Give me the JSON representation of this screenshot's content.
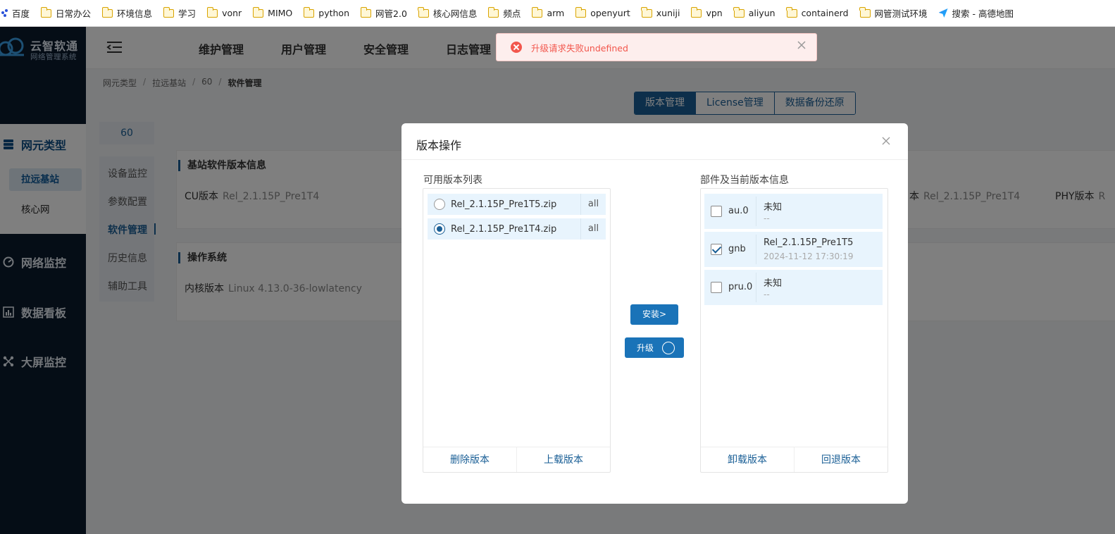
{
  "bookmarks": [
    {
      "label": "百度",
      "icon": "baidu-icon"
    },
    {
      "label": "日常办公",
      "icon": "folder-icon"
    },
    {
      "label": "环境信息",
      "icon": "folder-icon"
    },
    {
      "label": "学习",
      "icon": "folder-icon"
    },
    {
      "label": "vonr",
      "icon": "folder-icon"
    },
    {
      "label": "MIMO",
      "icon": "folder-icon"
    },
    {
      "label": "python",
      "icon": "folder-icon"
    },
    {
      "label": "网管2.0",
      "icon": "folder-icon"
    },
    {
      "label": "核心网信息",
      "icon": "folder-icon"
    },
    {
      "label": "频点",
      "icon": "folder-icon"
    },
    {
      "label": "arm",
      "icon": "folder-icon"
    },
    {
      "label": "openyurt",
      "icon": "folder-icon"
    },
    {
      "label": "xuniji",
      "icon": "folder-icon"
    },
    {
      "label": "vpn",
      "icon": "folder-icon"
    },
    {
      "label": "aliyun",
      "icon": "folder-icon"
    },
    {
      "label": "containerd",
      "icon": "folder-icon"
    },
    {
      "label": "网管测试环境",
      "icon": "folder-icon"
    },
    {
      "label": "搜索 - 高德地图",
      "icon": "gaode-map-icon"
    }
  ],
  "logo": {
    "title": "云智软通",
    "subtitle": "网络管理系统"
  },
  "sidebar": {
    "active_section": "网元类型",
    "sub_items": [
      "拉远基站",
      "核心网"
    ],
    "menus": [
      "网络监控",
      "数据看板",
      "大屏监控"
    ]
  },
  "header": {
    "nav": [
      "维护管理",
      "用户管理",
      "安全管理",
      "日志管理"
    ]
  },
  "breadcrumb": [
    "网元类型",
    "拉远基站",
    "60",
    "软件管理"
  ],
  "tabs": [
    "版本管理",
    "License管理",
    "数据备份还原"
  ],
  "ne_id": "60",
  "left_menu": [
    "设备监控",
    "参数配置",
    "软件管理",
    "历史信息",
    "辅助工具"
  ],
  "cards": {
    "software": {
      "title": "基站软件版本信息",
      "cu_label": "CU版本",
      "cu_value": "Rel_2.1.15P_Pre1T4",
      "right_label": "本",
      "right_value": "Rel_2.1.15P_Pre1T4",
      "phy_label": "PHY版本",
      "phy_value": "R"
    },
    "os": {
      "title": "操作系统",
      "kernel_label": "内核版本",
      "kernel_value": "Linux 4.13.0-36-lowlatency"
    }
  },
  "toast": {
    "message": "升级请求失败undefined",
    "status_color": "#f2564c"
  },
  "dialog": {
    "title": "版本操作",
    "available_label": "可用版本列表",
    "versions": [
      {
        "name": "Rel_2.1.15P_Pre1T5.zip",
        "tag": "all",
        "selected": false
      },
      {
        "name": "Rel_2.1.15P_Pre1T4.zip",
        "tag": "all",
        "selected": true
      }
    ],
    "available_actions": [
      "删除版本",
      "上载版本"
    ],
    "install_label": "安装>",
    "upgrade_label": "升级",
    "components_label": "部件及当前版本信息",
    "components": [
      {
        "name": "au.0",
        "version": "未知",
        "detail": "--",
        "checked": false
      },
      {
        "name": "gnb",
        "version": "Rel_2.1.15P_Pre1T5",
        "detail": "2024-11-12 17:30:19",
        "checked": true
      },
      {
        "name": "pru.0",
        "version": "未知",
        "detail": "--",
        "checked": false
      }
    ],
    "component_actions": [
      "卸载版本",
      "回退版本"
    ]
  },
  "colors": {
    "primary": "#1a5f96",
    "sidebar_bg": "#0b1a2c",
    "accent_button": "#1a73b8"
  }
}
